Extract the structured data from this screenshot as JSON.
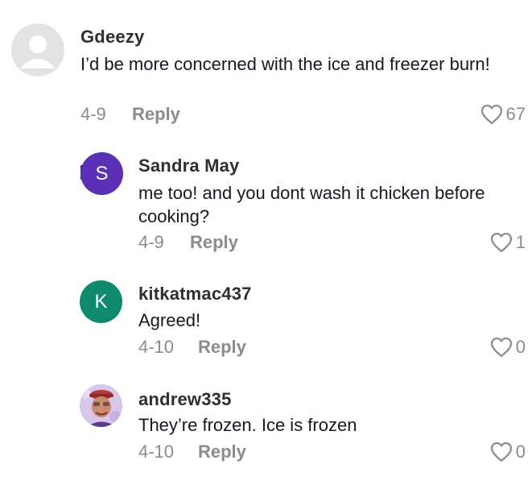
{
  "comments": [
    {
      "username": "Gdeezy",
      "text": "I’d be more concerned with the ice and freezer burn!",
      "date": "4-9",
      "reply_label": "Reply",
      "likes": "67",
      "avatar": {
        "type": "default-person",
        "color": "#e3e3e4"
      }
    },
    {
      "username": "Sandra May",
      "text": "me too! and you dont wash it chicken before cooking?",
      "date": "4-9",
      "reply_label": "Reply",
      "likes": "1",
      "avatar": {
        "type": "initial",
        "initial": "S",
        "color": "#5a30b6"
      }
    },
    {
      "username": "kitkatmac437",
      "text": "Agreed!",
      "date": "4-10",
      "reply_label": "Reply",
      "likes": "0",
      "avatar": {
        "type": "initial",
        "initial": "K",
        "color": "#0f8a6e"
      }
    },
    {
      "username": "andrew335",
      "text": "They’re frozen. Ice is frozen",
      "date": "4-10",
      "reply_label": "Reply",
      "likes": "0",
      "avatar": {
        "type": "photo"
      }
    }
  ],
  "icons": {
    "like": "heart-outline-icon",
    "default_avatar": "person-icon"
  },
  "colors": {
    "meta_gray": "#8a8b91",
    "text": "#161823"
  }
}
